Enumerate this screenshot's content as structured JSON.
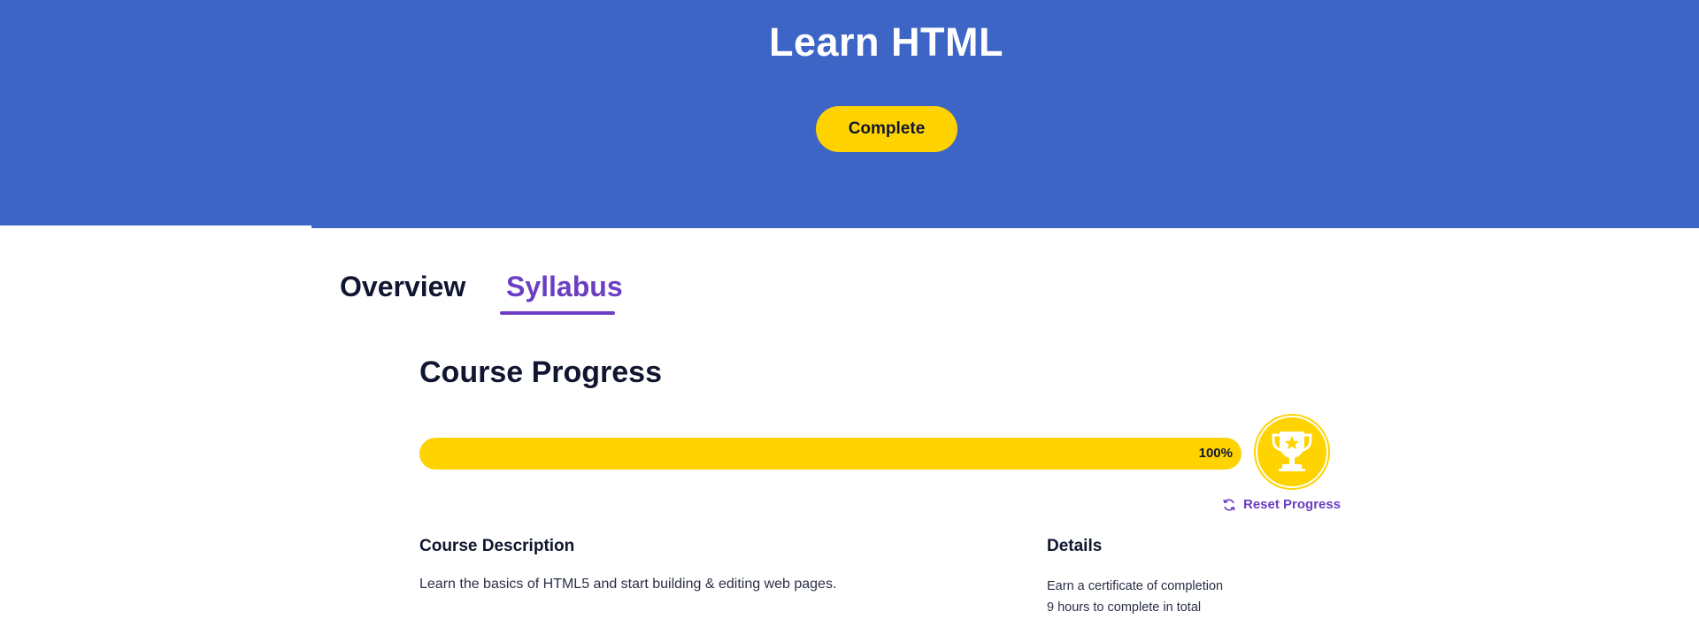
{
  "hero": {
    "title": "Learn HTML",
    "complete_button_label": "Complete"
  },
  "tabs": [
    {
      "label": "Overview",
      "active": false
    },
    {
      "label": "Syllabus",
      "active": true
    }
  ],
  "progress": {
    "title": "Course Progress",
    "percent": 100,
    "percent_label": "100%",
    "reset_label": "Reset Progress"
  },
  "description": {
    "title": "Course Description",
    "text": "Learn the basics of HTML5 and start building & editing web pages."
  },
  "details": {
    "title": "Details",
    "items": [
      "Earn a certificate of completion",
      "9 hours to complete in total"
    ]
  },
  "colors": {
    "hero_bg": "#3c65c6",
    "accent_yellow": "#ffd300",
    "accent_purple": "#6b3ec3",
    "text_dark": "#10162f"
  },
  "icons": {
    "trophy": "trophy-icon",
    "reset": "refresh-icon"
  }
}
